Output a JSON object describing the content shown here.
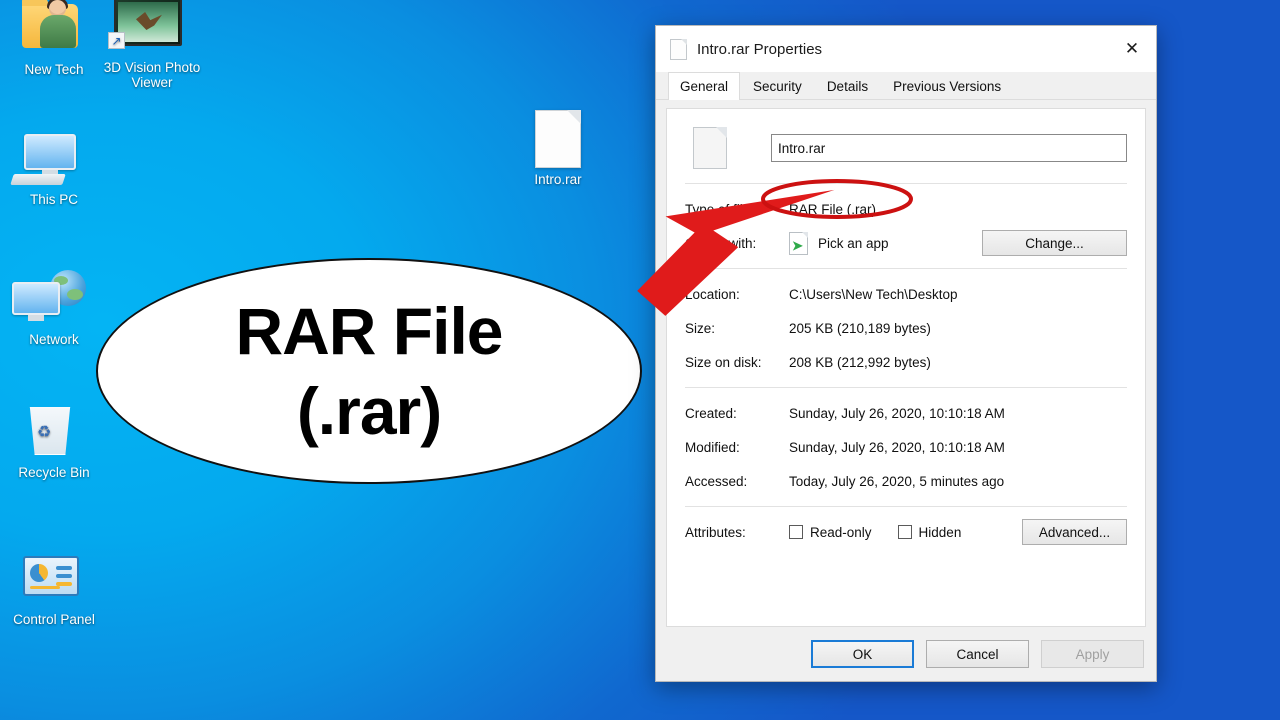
{
  "desktop": {
    "icons": [
      {
        "name": "New Tech",
        "type": "user-folder-icon"
      },
      {
        "name": "3D Vision Photo Viewer",
        "type": "photo-viewer-shortcut-icon"
      },
      {
        "name": "This PC",
        "type": "this-pc-icon"
      },
      {
        "name": "Network",
        "type": "network-icon"
      },
      {
        "name": "Recycle Bin",
        "type": "recycle-bin-icon"
      },
      {
        "name": "Control Panel",
        "type": "control-panel-icon"
      },
      {
        "name": "Intro.rar",
        "type": "generic-file-icon"
      }
    ],
    "background_left_color": "#04aeee",
    "background_right_color": "#1557c8"
  },
  "callout": {
    "line1": "RAR File",
    "line2": "(.rar)",
    "fill_color": "#ffffff",
    "outline_color": "#111111",
    "arrow_color": "#e01b1b",
    "highlight_ellipse_color": "#cc1111"
  },
  "dialog": {
    "title": "Intro.rar Properties",
    "close_label": "✕",
    "tabs": [
      {
        "label": "General",
        "active": true
      },
      {
        "label": "Security",
        "active": false
      },
      {
        "label": "Details",
        "active": false
      },
      {
        "label": "Previous Versions",
        "active": false
      }
    ],
    "filename": "Intro.rar",
    "fields": {
      "type_of_file_label": "Type of file:",
      "type_of_file_value": "RAR File (.rar)",
      "opens_with_label": "Opens with:",
      "opens_with_value": "Pick an app",
      "change_button": "Change...",
      "location_label": "Location:",
      "location_value": "C:\\Users\\New Tech\\Desktop",
      "size_label": "Size:",
      "size_value": "205 KB (210,189 bytes)",
      "size_on_disk_label": "Size on disk:",
      "size_on_disk_value": "208 KB (212,992 bytes)",
      "created_label": "Created:",
      "created_value": "Sunday, July 26, 2020, 10:10:18 AM",
      "modified_label": "Modified:",
      "modified_value": "Sunday, July 26, 2020, 10:10:18 AM",
      "accessed_label": "Accessed:",
      "accessed_value": "Today, July 26, 2020, 5 minutes ago",
      "attributes_label": "Attributes:",
      "readonly_label": "Read-only",
      "hidden_label": "Hidden",
      "advanced_button": "Advanced..."
    },
    "buttons": {
      "ok": "OK",
      "cancel": "Cancel",
      "apply": "Apply"
    }
  }
}
